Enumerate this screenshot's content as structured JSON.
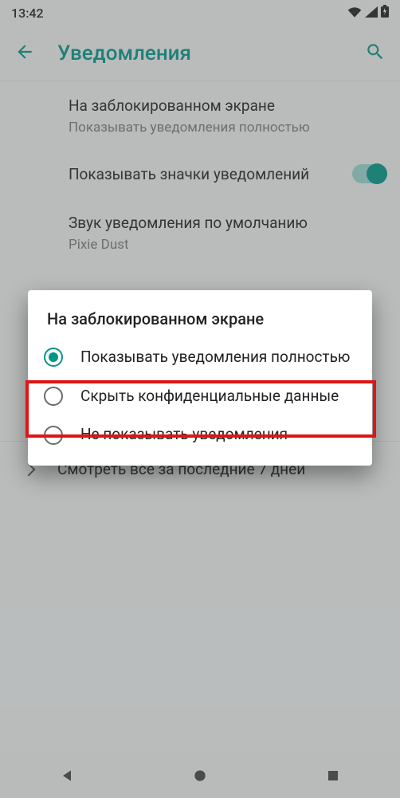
{
  "status": {
    "time": "13:42"
  },
  "appbar": {
    "title": "Уведомления"
  },
  "settings": {
    "lockscreen": {
      "title": "На заблокированном экране",
      "subtitle": "Показывать уведомления полностью"
    },
    "badges": {
      "title": "Показывать значки уведомлений"
    },
    "sound": {
      "title": "Звук уведомления по умолчанию",
      "subtitle": "Pixie Dust"
    },
    "recent": "Смотреть все за последние 7 дней"
  },
  "dialog": {
    "title": "На заблокированном экране",
    "options": [
      {
        "label": "Показывать уведомления полностью",
        "checked": true
      },
      {
        "label": "Скрыть конфиденциальные данные",
        "checked": false
      },
      {
        "label": "Не показывать уведомления",
        "checked": false
      }
    ]
  }
}
